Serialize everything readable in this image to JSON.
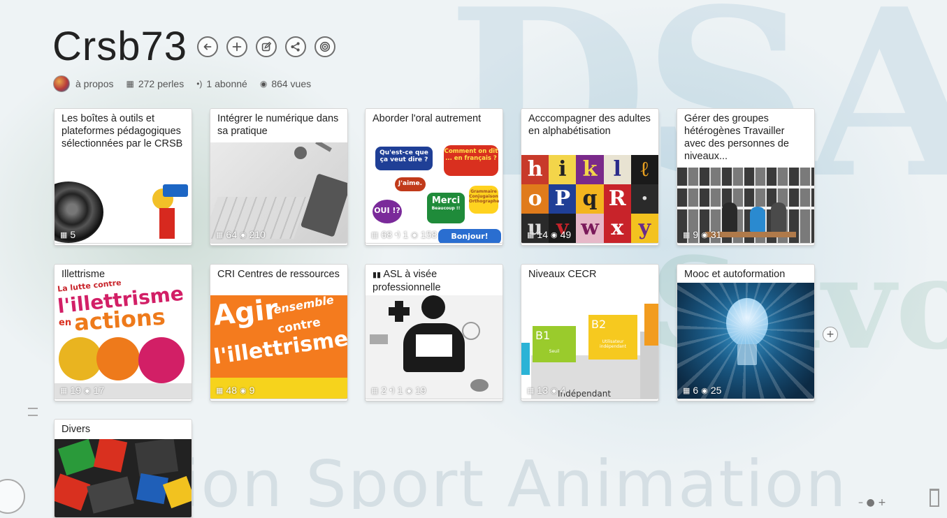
{
  "header": {
    "title": "Crsb73",
    "buttons": [
      {
        "name": "back-arrow-icon"
      },
      {
        "name": "add-icon"
      },
      {
        "name": "edit-icon"
      },
      {
        "name": "share-icon"
      },
      {
        "name": "follow-icon"
      }
    ]
  },
  "meta": {
    "about": "à propos",
    "pearls": "272 perles",
    "subscribers": "1 abonné",
    "views": "864 vues"
  },
  "cards": [
    {
      "title": "Les boîtes à outils et plateformes pédagogiques sélectionnées par le CRSB",
      "pearls": "5",
      "subs": "",
      "views": ""
    },
    {
      "title": "Intégrer le numérique dans sa pratique",
      "pearls": "64",
      "subs": "",
      "views": "210"
    },
    {
      "title": "Aborder l'oral autrement",
      "pearls": "68",
      "subs": "1",
      "views": "158"
    },
    {
      "title": "Acccompagner des adultes en alphabétisation",
      "pearls": "14",
      "subs": "",
      "views": "49"
    },
    {
      "title": "Gérer des groupes hétérogènes Travailler avec des personnes de niveaux...",
      "pearls": "9",
      "subs": "",
      "views": "31"
    },
    {
      "title": "Illettrisme",
      "pearls": "19",
      "subs": "",
      "views": "17"
    },
    {
      "title": "CRI Centres de ressources",
      "pearls": "48",
      "subs": "",
      "views": "9"
    },
    {
      "title": "ASL à visée professionnelle",
      "pearls": "2",
      "subs": "1",
      "views": "19"
    },
    {
      "title": "Niveaux CECR",
      "pearls": "13",
      "subs": "",
      "views": "4"
    },
    {
      "title": "Mooc et autoformation",
      "pearls": "6",
      "subs": "",
      "views": "25"
    },
    {
      "title": "Divers",
      "pearls": "",
      "subs": "",
      "views": ""
    }
  ],
  "image_text": {
    "oral_bubble1": "Qu'est-ce que ça veut dire ?",
    "oral_bubble2": "Comment on dit ... en français ?",
    "oral_bubble3": "J'aime.",
    "oral_bubble4": "Merci",
    "oral_bubble4b": "Beaucoup !!",
    "oral_bubble5": "OUI !?",
    "oral_bubble6": "Grammaire Conjugaison Orthographe",
    "oral_bubble7": "Bonjour!",
    "illettrisme_line1": "La lutte contre",
    "illettrisme_line2": "l'illettrisme",
    "illettrisme_line3": "en",
    "illettrisme_line4": "actions",
    "cri_line1": "Agir",
    "cri_line2": "ensemble",
    "cri_line3": "contre",
    "cri_line4": "l'illettrisme",
    "cecr_b1": "B1",
    "cecr_b1_sub": "Seuil",
    "cecr_b2": "B2",
    "cecr_b2_sub": "Utilisateur indépendant",
    "cecr_bottom": "Indépendant"
  },
  "bg_watermark": {
    "top": "DSA",
    "savoie": "Savoie",
    "line": "ion Sport Animation"
  },
  "colors": {
    "accent_red": "#d9301f",
    "accent_orange": "#ee7a1b",
    "accent_pink": "#d21f66",
    "accent_blue": "#1f5fb8",
    "accent_green": "#72b632"
  }
}
